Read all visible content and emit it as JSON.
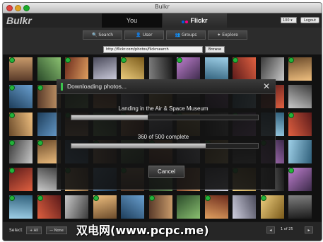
{
  "window": {
    "title": "Bulkr"
  },
  "header": {
    "logo": "Bulkr",
    "tabs": [
      {
        "label": "You"
      },
      {
        "label": "Flickr"
      }
    ],
    "per_page": "100 ▾",
    "logout": "Logout"
  },
  "nav": {
    "buttons": [
      {
        "label": "Search",
        "icon": "search-icon"
      },
      {
        "label": "User",
        "icon": "user-icon"
      },
      {
        "label": "Groups",
        "icon": "groups-icon"
      },
      {
        "label": "Explore",
        "icon": "explore-icon"
      }
    ]
  },
  "url_bar": {
    "value": "http://flickr.com/photos/flickrsearch",
    "browse": "Browse"
  },
  "dialog": {
    "title": "Downloading photos...",
    "current_item": "Landing in the Air & Space Museum",
    "current_progress": 0.41,
    "overall_text": "360 of 500 complete",
    "overall_progress": 0.72,
    "cancel": "Cancel"
  },
  "footer": {
    "select_label": "Select",
    "all": "+ All",
    "none": "— None",
    "page": "1 of 25",
    "prev": "◂",
    "next": "▸"
  },
  "watermark": "双电网(www.pcpc.me)",
  "colors": {
    "flickr_blue": "#0063dc",
    "flickr_pink": "#ff0084",
    "check_green": "#23b33a"
  }
}
